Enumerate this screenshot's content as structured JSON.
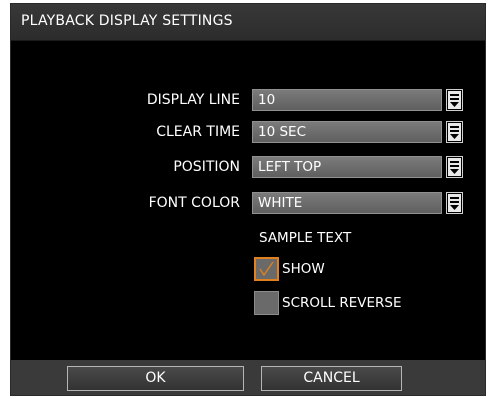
{
  "dialog": {
    "title": "PLAYBACK DISPLAY SETTINGS"
  },
  "fields": [
    {
      "label": "DISPLAY LINE",
      "value": "10"
    },
    {
      "label": "CLEAR TIME",
      "value": "10 SEC"
    },
    {
      "label": "POSITION",
      "value": "LEFT TOP"
    },
    {
      "label": "FONT COLOR",
      "value": "WHITE"
    }
  ],
  "sample_text": "SAMPLE TEXT",
  "options": {
    "show": {
      "label": "SHOW",
      "checked": true
    },
    "scroll_reverse": {
      "label": "SCROLL REVERSE",
      "checked": false
    }
  },
  "buttons": {
    "ok": "OK",
    "cancel": "CANCEL"
  },
  "icons": {
    "dropdown": "chevron-down-icon",
    "check": "check-icon"
  },
  "colors": {
    "background": "#000000",
    "title_bar": "#333333",
    "field": "#6d6d6d",
    "checkbox_focus": "#e0801e",
    "button_bar": "#3a3a3a"
  }
}
